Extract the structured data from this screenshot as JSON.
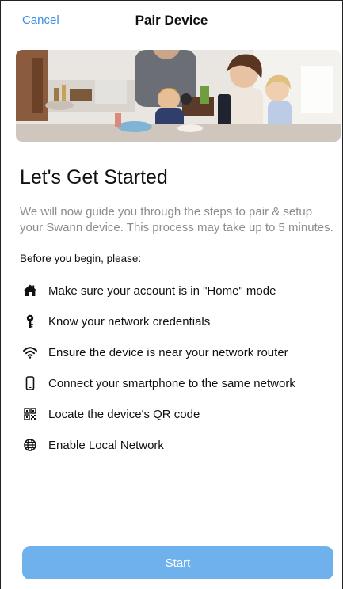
{
  "nav": {
    "cancel_label": "Cancel",
    "title": "Pair Device"
  },
  "hero": {
    "image_semantic": "family-at-kitchen-table-photo"
  },
  "content": {
    "heading": "Let's Get Started",
    "intro": "We will now guide you through the steps to pair & setup your Swann device. This process may take up to 5 minutes.",
    "before_label": "Before you begin, please:",
    "steps": [
      {
        "icon": "home-icon",
        "text": "Make sure your account is in \"Home\" mode"
      },
      {
        "icon": "key-icon",
        "text": "Know your network credentials"
      },
      {
        "icon": "wifi-icon",
        "text": "Ensure the device is near your network router"
      },
      {
        "icon": "smartphone-icon",
        "text": "Connect your smartphone to the same network"
      },
      {
        "icon": "qr-code-icon",
        "text": "Locate the device's QR code"
      },
      {
        "icon": "globe-icon",
        "text": "Enable Local Network"
      }
    ]
  },
  "footer": {
    "start_label": "Start"
  },
  "colors": {
    "accent": "#3a8ee6",
    "button": "#6fb1ec",
    "muted_text": "#8c8c8c"
  }
}
